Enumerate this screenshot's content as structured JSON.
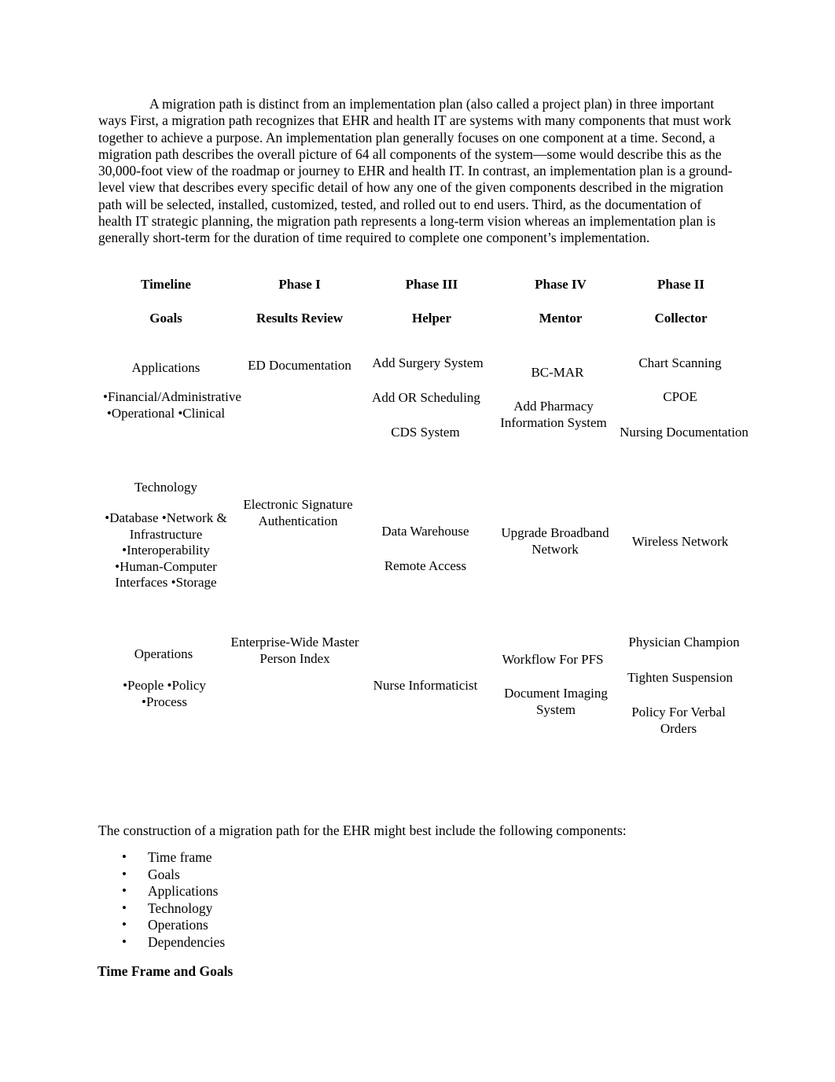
{
  "document": {
    "intro_paragraph": "A migration path is distinct from an implementation plan (also called a project plan) in three important ways First, a migration path recognizes that EHR and health IT are systems with many components that must work together to achieve a purpose. An implementation plan generally focuses on one component at a time. Second, a migration path describes the overall picture of 64 all components of the system—some would describe this as the 30,000-foot view of the roadmap or journey to EHR and health IT. In contrast, an implementation plan is a ground-level view that describes every specific detail of how any one of the given components described in the migration path will be selected, installed, customized, tested, and rolled out to end users. Third, as the documentation of health IT strategic planning, the migration path represents a long-term vision whereas an implementation plan is generally short-term for the duration of time required to complete one component’s implementation.",
    "closing_paragraph": "The construction of a migration path for the EHR might best include the following components:",
    "components_list": [
      "Time frame",
      "Goals",
      "Applications",
      "Technology",
      "Operations",
      "Dependencies"
    ],
    "bullet_glyph": "•",
    "subheading": "Time Frame and Goals"
  },
  "migration_table": {
    "headers": [
      {
        "top": "Timeline",
        "bottom": "Goals"
      },
      {
        "top": "Phase I",
        "bottom": "Results Review"
      },
      {
        "top": "Phase III",
        "bottom": "Helper"
      },
      {
        "top": "Phase IV",
        "bottom": "Mentor"
      },
      {
        "top": "Phase II",
        "bottom": "Collector"
      }
    ],
    "rows": [
      {
        "category": "Applications",
        "category_bullets": "•Financial/Administrative •Operational •Clinical",
        "phase_i": [
          "ED Documentation"
        ],
        "phase_iii": [
          "Add Surgery System",
          "Add OR Scheduling",
          "CDS System"
        ],
        "phase_iv": [
          "BC-MAR",
          "Add Pharmacy Information System"
        ],
        "phase_ii": [
          "Chart Scanning",
          "CPOE",
          "Nursing Documentation"
        ]
      },
      {
        "category": "Technology",
        "category_bullets": "•Database •Network & Infrastructure •Interoperability •Human-Computer Interfaces •Storage",
        "phase_i": [
          "Electronic Signature Authentication"
        ],
        "phase_iii": [
          "Data Warehouse",
          "Remote Access"
        ],
        "phase_iv": [
          "Upgrade Broadband Network"
        ],
        "phase_ii": [
          "Wireless Network"
        ]
      },
      {
        "category": "Operations",
        "category_bullets": "•People •Policy •Process",
        "phase_i": [
          "Enterprise-Wide Master Person Index"
        ],
        "phase_iii": [
          "Nurse Informaticist"
        ],
        "phase_iv": [
          "Workflow For PFS",
          "Document Imaging System"
        ],
        "phase_ii": [
          "Physician Champion",
          "Tighten Suspension",
          "Policy For Verbal Orders"
        ]
      }
    ]
  }
}
